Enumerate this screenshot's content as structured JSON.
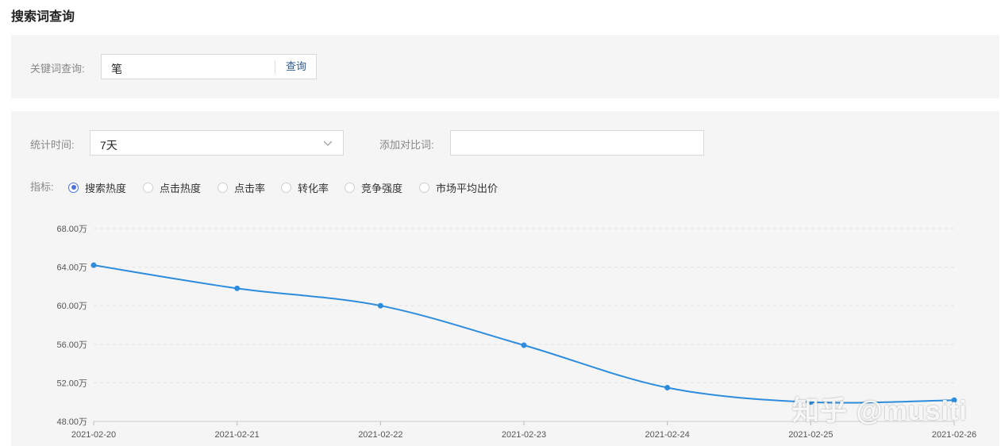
{
  "page": {
    "title": "搜索词查询"
  },
  "search": {
    "label": "关键词查询:",
    "value": "笔",
    "button": "查询"
  },
  "filters": {
    "period_label": "统计时间:",
    "period_value": "7天",
    "compare_label": "添加对比词:",
    "compare_value": "",
    "metric_label": "指标:",
    "metrics": [
      {
        "label": "搜索热度",
        "checked": true
      },
      {
        "label": "点击热度",
        "checked": false
      },
      {
        "label": "点击率",
        "checked": false
      },
      {
        "label": "转化率",
        "checked": false
      },
      {
        "label": "竞争强度",
        "checked": false
      },
      {
        "label": "市场平均出价",
        "checked": false
      }
    ]
  },
  "chart_data": {
    "type": "line",
    "x": [
      "2021-02-20",
      "2021-02-21",
      "2021-02-22",
      "2021-02-23",
      "2021-02-24",
      "2021-02-25",
      "2021-02-26"
    ],
    "series": [
      {
        "values": [
          64.2,
          61.8,
          60.0,
          55.9,
          51.5,
          50.0,
          50.2
        ]
      }
    ],
    "yticks": [
      48,
      52,
      56,
      60,
      64,
      68
    ],
    "ytick_labels": [
      "48.00万",
      "52.00万",
      "56.00万",
      "60.00万",
      "64.00万",
      "68.00万"
    ],
    "ylim": [
      48,
      68
    ],
    "title": "",
    "xlabel": "",
    "ylabel": "",
    "grid": true,
    "color": "#2d8cdc"
  },
  "watermark": "知乎 @musiti"
}
